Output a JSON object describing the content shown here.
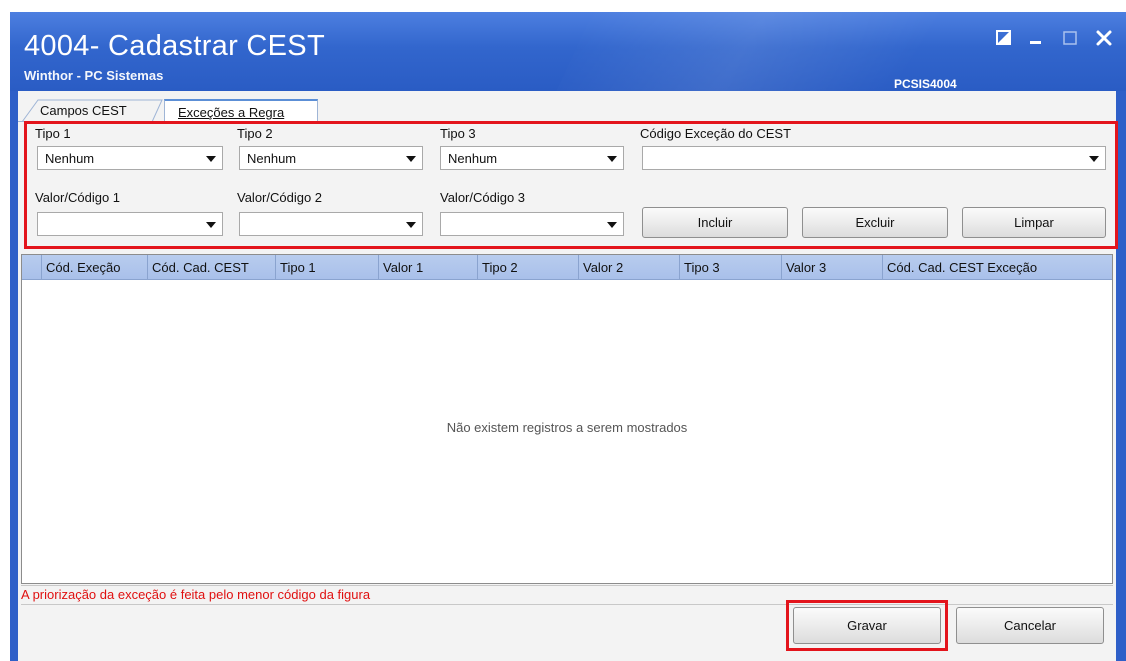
{
  "window": {
    "title": "4004- Cadastrar CEST",
    "subtitle": "Winthor - PC Sistemas",
    "program_code": "PCSIS4004",
    "controls": [
      "restore-icon",
      "minimize-icon",
      "maximize-icon",
      "close-icon"
    ]
  },
  "tabs": [
    {
      "label": "Campos CEST",
      "active": false
    },
    {
      "label": "Exceções a Regra",
      "active": true
    }
  ],
  "form": {
    "tipo1": {
      "label": "Tipo 1",
      "value": "Nenhum"
    },
    "tipo2": {
      "label": "Tipo 2",
      "value": "Nenhum"
    },
    "tipo3": {
      "label": "Tipo 3",
      "value": "Nenhum"
    },
    "codigo_excecao": {
      "label": "Código Exceção do CEST",
      "value": ""
    },
    "valor1": {
      "label": "Valor/Código 1",
      "value": ""
    },
    "valor2": {
      "label": "Valor/Código 2",
      "value": ""
    },
    "valor3": {
      "label": "Valor/Código 3",
      "value": ""
    },
    "buttons": {
      "incluir": "Incluir",
      "excluir": "Excluir",
      "limpar": "Limpar"
    }
  },
  "grid": {
    "columns": [
      "Cód. Exeção",
      "Cód. Cad. CEST",
      "Tipo 1",
      "Valor 1",
      "Tipo 2",
      "Valor 2",
      "Tipo 3",
      "Valor 3",
      "Cód. Cad. CEST Exceção"
    ],
    "empty_message": "Não existem registros a serem mostrados"
  },
  "footer": {
    "note": "A priorização da exceção é feita pelo menor código da figura",
    "save_label": "Gravar",
    "cancel_label": "Cancelar"
  },
  "colors": {
    "titlebar": "#3266cd",
    "highlight": "#e3141c",
    "note": "#e01010"
  }
}
